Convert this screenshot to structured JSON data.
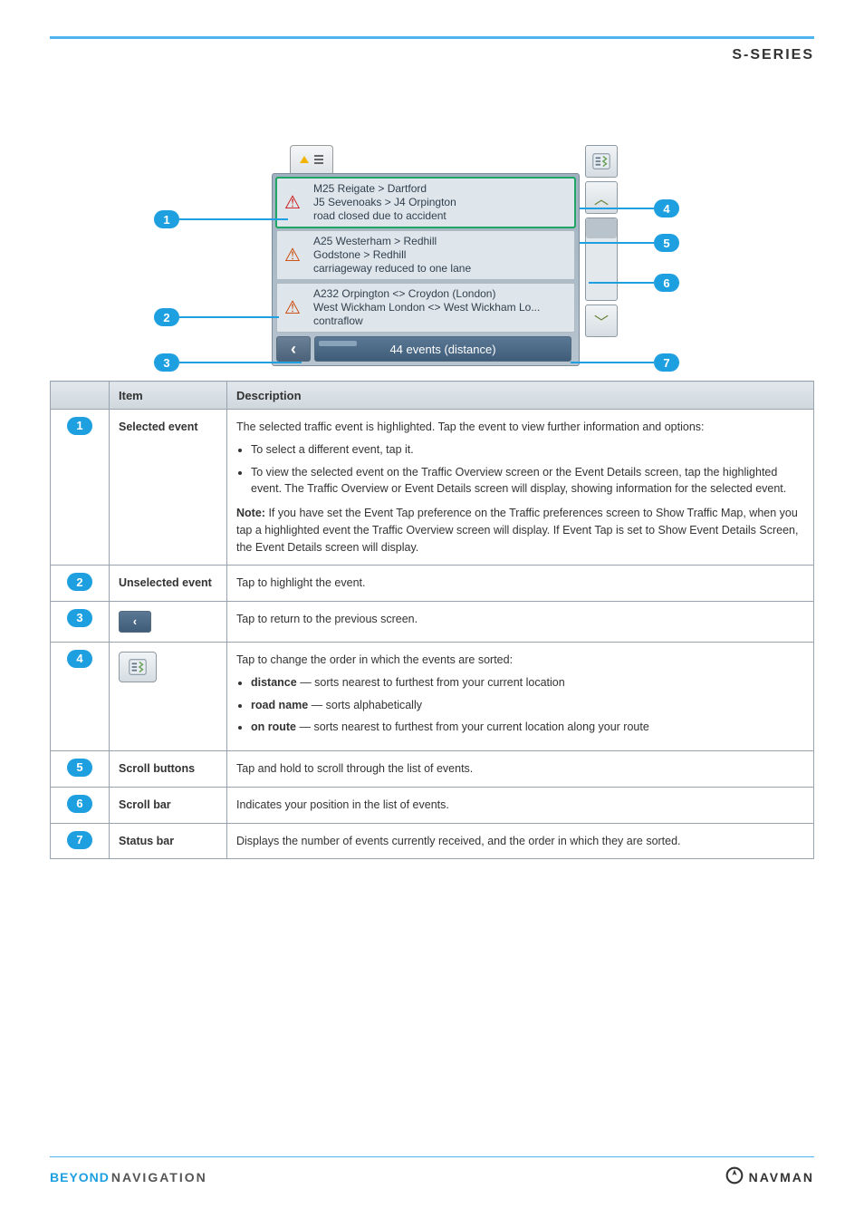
{
  "header": {
    "series_label": "S-SERIES"
  },
  "figure": {
    "events": [
      {
        "line1": "M25 Reigate > Dartford",
        "line2": "J5 Sevenoaks > J4 Orpington",
        "line3": "road closed due to accident",
        "icon": "road-closed",
        "selected": true
      },
      {
        "line1": "A25 Westerham > Redhill",
        "line2": "Godstone > Redhill",
        "line3": "carriageway reduced to one lane",
        "icon": "roadworks",
        "selected": false
      },
      {
        "line1": "A232 Orpington <> Croydon (London)",
        "line2": "West Wickham London <> West Wickham Lo...",
        "line3": "contraflow",
        "icon": "roadworks",
        "selected": false
      }
    ],
    "status_text": "44 events (distance)",
    "scroll_up_glyph": "︿",
    "scroll_down_glyph": "﹀",
    "back_glyph": "‹"
  },
  "table": {
    "headers": {
      "col1": "",
      "col2": "Item",
      "col3": "Description"
    },
    "rows": [
      {
        "num": "1",
        "item": "Selected event",
        "desc": "The selected traffic event is highlighted. Tap the event to view further information and options:",
        "sub": [
          "To select a different event, tap it.",
          "To view the selected event on the Traffic Overview screen or the Event Details screen, tap the highlighted event. The Traffic Overview or Event Details screen will display, showing information for the selected event."
        ],
        "note_label": "Note:",
        "note_text": "If you have set the Event Tap preference on the Traffic preferences screen to Show Traffic Map, when you tap a highlighted event the Traffic Overview screen will display. If Event Tap is set to Show Event Details Screen, the Event Details screen will display."
      },
      {
        "num": "2",
        "item": "Unselected event",
        "desc_label": "Tap to highlight the event."
      },
      {
        "num": "3",
        "item_icon": "back",
        "desc_label": "Tap to return to the previous screen."
      },
      {
        "num": "4",
        "item_icon": "map",
        "desc_label": "Tap to change the order in which the events are sorted:",
        "sort_options": [
          {
            "label": "distance",
            "meaning": "sorts nearest to furthest from your current location"
          },
          {
            "label": "road name",
            "meaning": "sorts alphabetically"
          },
          {
            "label": "on route",
            "meaning": "sorts nearest to furthest from your current location along your route"
          }
        ]
      },
      {
        "num": "5",
        "item": "Scroll buttons",
        "desc_label": "Tap and hold to scroll through the list of events."
      },
      {
        "num": "6",
        "item": "Scroll bar",
        "desc_label": "Indicates your position in the list of events."
      },
      {
        "num": "7",
        "item": "Status bar",
        "desc_label": "Displays the number of events currently received, and the order in which they are sorted."
      }
    ]
  },
  "footer": {
    "left_a": "BEYOND",
    "left_b": "NAVIGATION",
    "right": "NAVMAN"
  }
}
